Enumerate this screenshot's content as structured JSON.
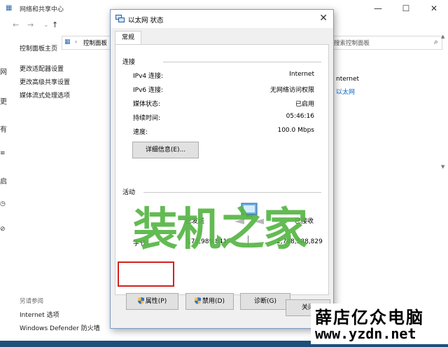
{
  "background_window": {
    "title": "网络和共享中心",
    "controls": [
      "—",
      "☐",
      "✕"
    ],
    "nav": [
      "←",
      "→",
      "↑"
    ],
    "address_text": "控制面板",
    "search_placeholder": "搜索控制面板",
    "sidebar_links": [
      "控制面板主页",
      "更改适配器设置",
      "更改高级共享设置",
      "媒体流式处理选项"
    ],
    "see_also_label": "另请参阅",
    "see_also_links": [
      "Internet 选项",
      "Windows Defender 防火墙"
    ],
    "right_info": [
      "nternet",
      "以太网"
    ],
    "edge_chars": [
      "网",
      "更",
      "有",
      "启"
    ]
  },
  "dialog": {
    "title": "以太网 状态",
    "tab": "常规",
    "connection": {
      "label": "连接",
      "rows": [
        {
          "label": "IPv4 连接:",
          "value": "Internet"
        },
        {
          "label": "IPv6 连接:",
          "value": "无网络访问权限"
        },
        {
          "label": "媒体状态:",
          "value": "已启用"
        },
        {
          "label": "持续时间:",
          "value": "05:46:16"
        },
        {
          "label": "速度:",
          "value": "100.0 Mbps"
        }
      ],
      "details_button": "详细信息(E)..."
    },
    "activity": {
      "label": "活动",
      "sent_label": "已发送",
      "received_label": "已接收",
      "bytes_label": "字节:",
      "sent_value": "175,989,841",
      "received_value": "2,748,588,829"
    },
    "buttons": {
      "properties": "属性(P)",
      "disable": "禁用(D)",
      "diagnose": "诊断(G)",
      "close": "关闭"
    }
  },
  "watermark": {
    "text": "装机之家",
    "badge_cn": "薛店亿众电脑",
    "badge_url": "www.yzdn.net"
  },
  "colors": {
    "highlight_box": "#d42020",
    "watermark_green": "#58b646",
    "link_blue": "#0066cc"
  }
}
